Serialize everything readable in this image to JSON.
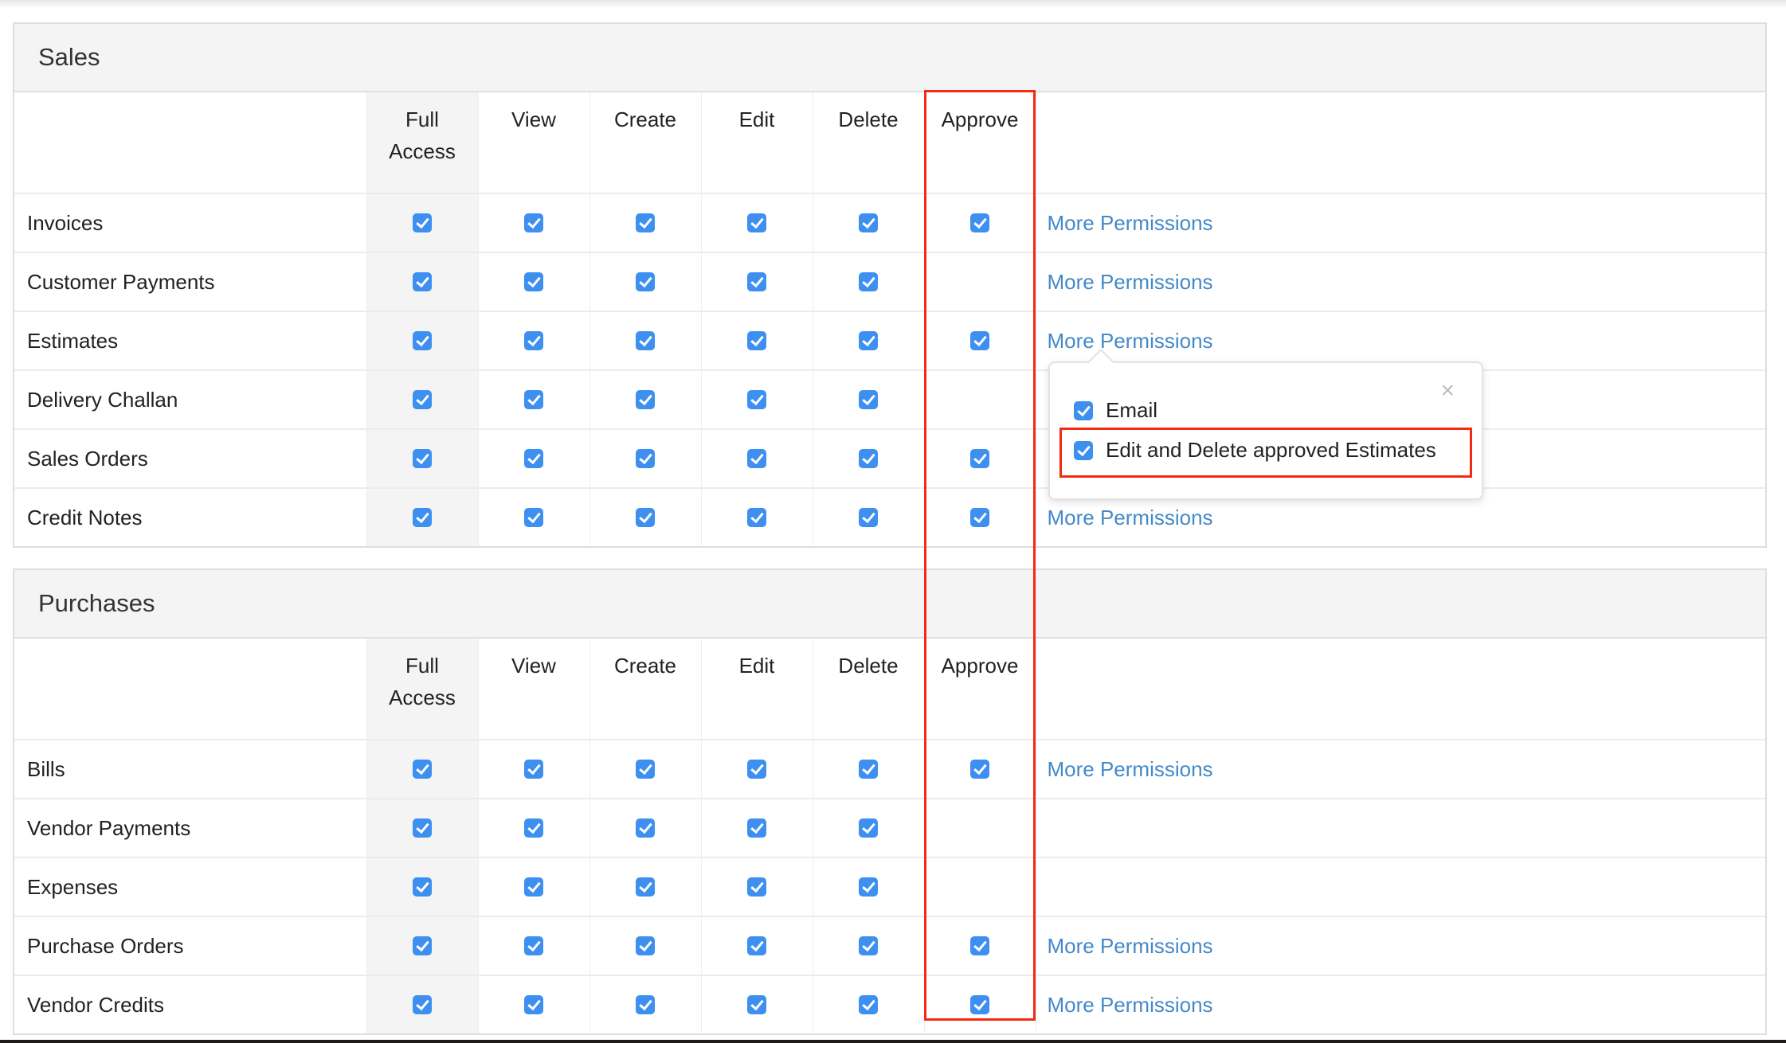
{
  "columns": [
    "Full\nAccess",
    "View",
    "Create",
    "Edit",
    "Delete",
    "Approve"
  ],
  "columns_display": {
    "full_access_1": "Full",
    "full_access_2": "Access",
    "view": "View",
    "create": "Create",
    "edit": "Edit",
    "delete": "Delete",
    "approve": "Approve"
  },
  "more_permissions_label": "More Permissions",
  "colors": {
    "accent": "#3d8ff0",
    "link": "#4489c8",
    "highlight": "#f22b12"
  },
  "sections": [
    {
      "title": "Sales",
      "rows": [
        {
          "label": "Invoices",
          "full": true,
          "view": true,
          "create": true,
          "edit": true,
          "delete": true,
          "approve": true,
          "more": true
        },
        {
          "label": "Customer Payments",
          "full": true,
          "view": true,
          "create": true,
          "edit": true,
          "delete": true,
          "approve": null,
          "more": true
        },
        {
          "label": "Estimates",
          "full": true,
          "view": true,
          "create": true,
          "edit": true,
          "delete": true,
          "approve": true,
          "more": true
        },
        {
          "label": "Delivery Challan",
          "full": true,
          "view": true,
          "create": true,
          "edit": true,
          "delete": true,
          "approve": null,
          "more": false
        },
        {
          "label": "Sales Orders",
          "full": true,
          "view": true,
          "create": true,
          "edit": true,
          "delete": true,
          "approve": true,
          "more": false
        },
        {
          "label": "Credit Notes",
          "full": true,
          "view": true,
          "create": true,
          "edit": true,
          "delete": true,
          "approve": true,
          "more": true
        }
      ]
    },
    {
      "title": "Purchases",
      "rows": [
        {
          "label": "Bills",
          "full": true,
          "view": true,
          "create": true,
          "edit": true,
          "delete": true,
          "approve": true,
          "more": true
        },
        {
          "label": "Vendor Payments",
          "full": true,
          "view": true,
          "create": true,
          "edit": true,
          "delete": true,
          "approve": null,
          "more": false
        },
        {
          "label": "Expenses",
          "full": true,
          "view": true,
          "create": true,
          "edit": true,
          "delete": true,
          "approve": null,
          "more": false
        },
        {
          "label": "Purchase Orders",
          "full": true,
          "view": true,
          "create": true,
          "edit": true,
          "delete": true,
          "approve": true,
          "more": true
        },
        {
          "label": "Vendor Credits",
          "full": true,
          "view": true,
          "create": true,
          "edit": true,
          "delete": true,
          "approve": true,
          "more": true
        }
      ]
    }
  ],
  "popover": {
    "close_icon": "×",
    "items": [
      {
        "label": "Email",
        "checked": true
      },
      {
        "label": "Edit and Delete approved Estimates",
        "checked": true
      }
    ]
  }
}
